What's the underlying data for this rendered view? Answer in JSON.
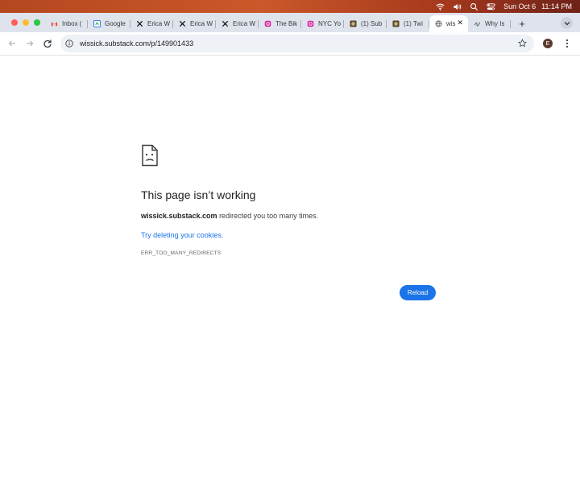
{
  "menubar": {
    "date": "Sun Oct 6",
    "time": "11:14 PM"
  },
  "tabs": [
    {
      "label": "Inbox (",
      "icon": "gmail-icon"
    },
    {
      "label": "Google",
      "icon": "google-icon"
    },
    {
      "label": "Erica W",
      "icon": "x-icon"
    },
    {
      "label": "Erica W",
      "icon": "x-icon"
    },
    {
      "label": "Erica W",
      "icon": "x-icon"
    },
    {
      "label": "The Bik",
      "icon": "instagram-icon"
    },
    {
      "label": "NYC Yo",
      "icon": "instagram-icon"
    },
    {
      "label": "(1) Sub",
      "icon": "substack-icon"
    },
    {
      "label": "(1) Twi",
      "icon": "substack-icon"
    },
    {
      "label": "wis",
      "icon": "globe-icon",
      "active": true
    },
    {
      "label": "Why Is",
      "icon": "script-icon"
    }
  ],
  "toolbar": {
    "url": "wissick.substack.com/p/149901433",
    "avatar_letter": "E"
  },
  "error": {
    "title": "This page isn’t working",
    "host": "wissick.substack.com",
    "message": " redirected you too many times.",
    "link": "Try deleting your cookies.",
    "code": "ERR_TOO_MANY_REDIRECTS",
    "reload_label": "Reload"
  },
  "colors": {
    "accent": "#1a73e8",
    "tabstrip": "#dfe3ec"
  }
}
